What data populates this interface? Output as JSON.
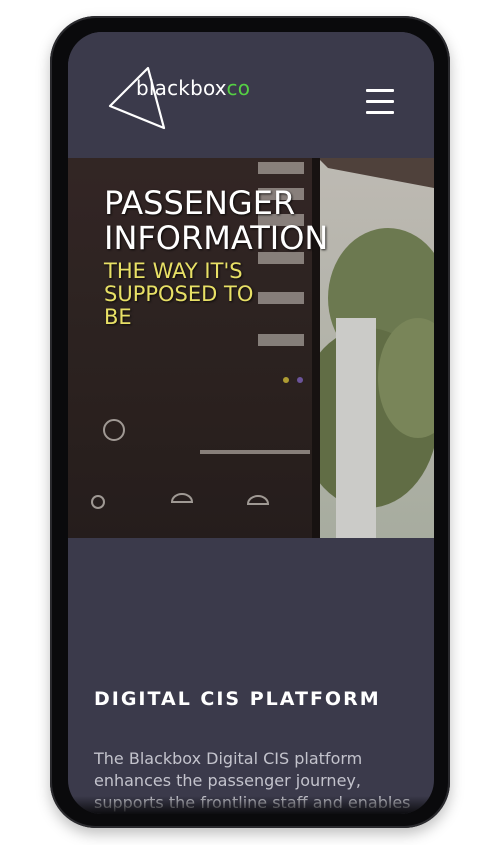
{
  "header": {
    "logo_text_main": "blackbox",
    "logo_text_accent": "co",
    "menu_icon": "hamburger-menu-icon"
  },
  "hero": {
    "title_line1": "PASSENGER",
    "title_line2": "INFORMATION",
    "subtitle": "THE WAY IT'S SUPPOSED TO BE",
    "image": "station-departure-board-photo"
  },
  "section": {
    "title": "DIGITAL CIS PLATFORM",
    "body": "The Blackbox Digital CIS platform enhances the passenger journey, supports the frontline staff and enables the control room to be more"
  },
  "colors": {
    "header_bg": "#3b3a4b",
    "logo_accent": "#55d044",
    "hero_subtitle": "#e8e066",
    "body_text": "#c3c3cc"
  }
}
